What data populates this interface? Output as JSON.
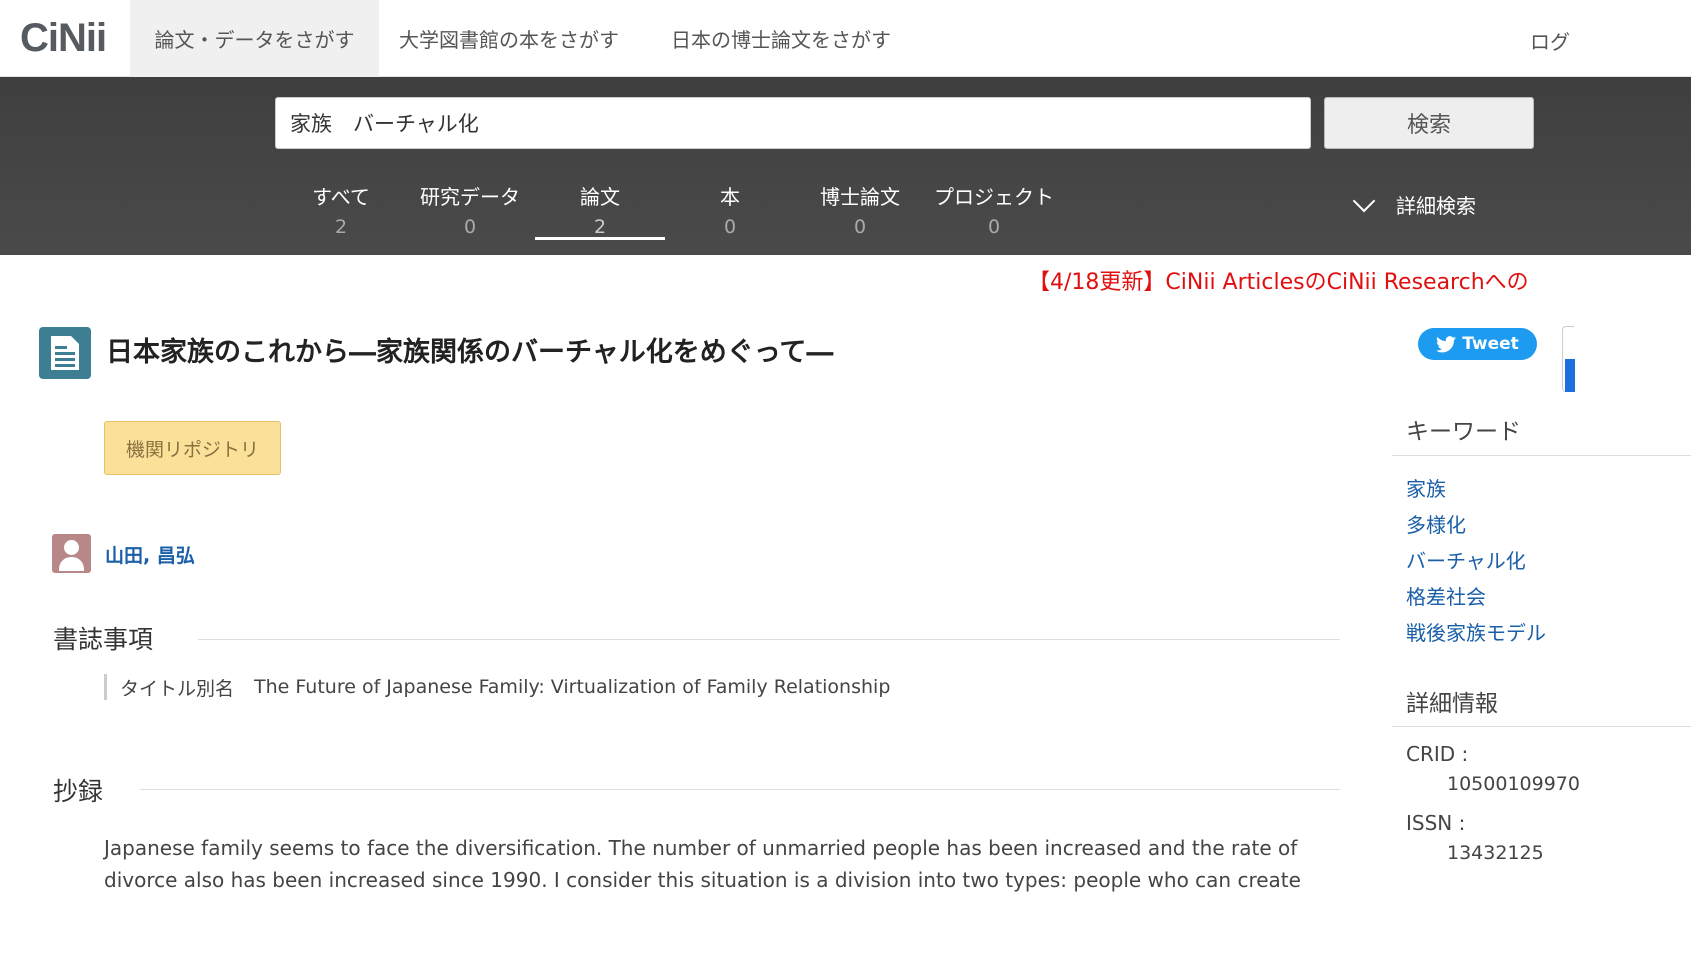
{
  "header": {
    "logo": "CiNii",
    "nav": [
      "論文・データをさがす",
      "大学図書館の本をさがす",
      "日本の博士論文をさがす"
    ],
    "login": "ログ"
  },
  "search": {
    "query": "家族　バーチャル化",
    "button": "検索",
    "advanced": "詳細検索"
  },
  "categories": [
    {
      "label": "すべて",
      "count": "2"
    },
    {
      "label": "研究データ",
      "count": "0"
    },
    {
      "label": "論文",
      "count": "2"
    },
    {
      "label": "本",
      "count": "0"
    },
    {
      "label": "博士論文",
      "count": "0"
    },
    {
      "label": "プロジェクト",
      "count": "0"
    }
  ],
  "notice": "【4/18更新】CiNii ArticlesのCiNii Researchへの",
  "article": {
    "title": "日本家族のこれから―家族関係のバーチャル化をめぐって―",
    "tweet": "Tweet",
    "repository": "機関リポジトリ",
    "author": "山田, 昌弘",
    "biblio_heading": "書誌事項",
    "alt_title_label": "タイトル別名",
    "alt_title": "The Future of Japanese Family: Virtualization of Family Relationship",
    "abstract_heading": "抄録",
    "abstract": "Japanese family seems to face the diversification. The number of unmarried people has been increased and the rate of divorce also has been increased since 1990. I consider this situation is a division into two types: people who can create"
  },
  "sidebar": {
    "keywords_heading": "キーワード",
    "keywords": [
      "家族",
      "多様化",
      "バーチャル化",
      "格差社会",
      "戦後家族モデル"
    ],
    "details_heading": "詳細情報",
    "crid_label": "CRID :",
    "crid": "10500109970",
    "issn_label": "ISSN :",
    "issn": "13432125"
  },
  "colors": {
    "accent_link": "#1a5fa8",
    "search_band": "#444444",
    "notice": "#e01010",
    "repo_badge": "#fbe09a",
    "tweet": "#1d9bf0"
  }
}
